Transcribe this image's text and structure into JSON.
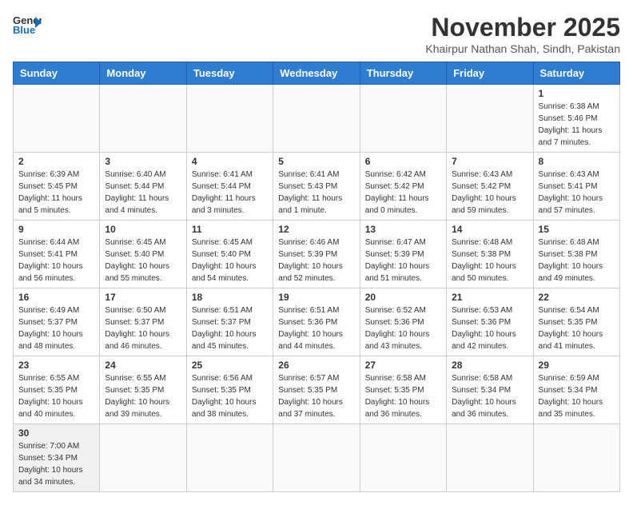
{
  "header": {
    "logo_line1": "General",
    "logo_line2": "Blue",
    "month_title": "November 2025",
    "location": "Khairpur Nathan Shah, Sindh, Pakistan"
  },
  "weekdays": [
    "Sunday",
    "Monday",
    "Tuesday",
    "Wednesday",
    "Thursday",
    "Friday",
    "Saturday"
  ],
  "weeks": [
    [
      {
        "day": "",
        "sunrise": "",
        "sunset": "",
        "daylight": ""
      },
      {
        "day": "",
        "sunrise": "",
        "sunset": "",
        "daylight": ""
      },
      {
        "day": "",
        "sunrise": "",
        "sunset": "",
        "daylight": ""
      },
      {
        "day": "",
        "sunrise": "",
        "sunset": "",
        "daylight": ""
      },
      {
        "day": "",
        "sunrise": "",
        "sunset": "",
        "daylight": ""
      },
      {
        "day": "",
        "sunrise": "",
        "sunset": "",
        "daylight": ""
      },
      {
        "day": "1",
        "sunrise": "Sunrise: 6:38 AM",
        "sunset": "Sunset: 5:46 PM",
        "daylight": "Daylight: 11 hours and 7 minutes."
      }
    ],
    [
      {
        "day": "2",
        "sunrise": "Sunrise: 6:39 AM",
        "sunset": "Sunset: 5:45 PM",
        "daylight": "Daylight: 11 hours and 5 minutes."
      },
      {
        "day": "3",
        "sunrise": "Sunrise: 6:40 AM",
        "sunset": "Sunset: 5:44 PM",
        "daylight": "Daylight: 11 hours and 4 minutes."
      },
      {
        "day": "4",
        "sunrise": "Sunrise: 6:41 AM",
        "sunset": "Sunset: 5:44 PM",
        "daylight": "Daylight: 11 hours and 3 minutes."
      },
      {
        "day": "5",
        "sunrise": "Sunrise: 6:41 AM",
        "sunset": "Sunset: 5:43 PM",
        "daylight": "Daylight: 11 hours and 1 minute."
      },
      {
        "day": "6",
        "sunrise": "Sunrise: 6:42 AM",
        "sunset": "Sunset: 5:42 PM",
        "daylight": "Daylight: 11 hours and 0 minutes."
      },
      {
        "day": "7",
        "sunrise": "Sunrise: 6:43 AM",
        "sunset": "Sunset: 5:42 PM",
        "daylight": "Daylight: 10 hours and 59 minutes."
      },
      {
        "day": "8",
        "sunrise": "Sunrise: 6:43 AM",
        "sunset": "Sunset: 5:41 PM",
        "daylight": "Daylight: 10 hours and 57 minutes."
      }
    ],
    [
      {
        "day": "9",
        "sunrise": "Sunrise: 6:44 AM",
        "sunset": "Sunset: 5:41 PM",
        "daylight": "Daylight: 10 hours and 56 minutes."
      },
      {
        "day": "10",
        "sunrise": "Sunrise: 6:45 AM",
        "sunset": "Sunset: 5:40 PM",
        "daylight": "Daylight: 10 hours and 55 minutes."
      },
      {
        "day": "11",
        "sunrise": "Sunrise: 6:45 AM",
        "sunset": "Sunset: 5:40 PM",
        "daylight": "Daylight: 10 hours and 54 minutes."
      },
      {
        "day": "12",
        "sunrise": "Sunrise: 6:46 AM",
        "sunset": "Sunset: 5:39 PM",
        "daylight": "Daylight: 10 hours and 52 minutes."
      },
      {
        "day": "13",
        "sunrise": "Sunrise: 6:47 AM",
        "sunset": "Sunset: 5:39 PM",
        "daylight": "Daylight: 10 hours and 51 minutes."
      },
      {
        "day": "14",
        "sunrise": "Sunrise: 6:48 AM",
        "sunset": "Sunset: 5:38 PM",
        "daylight": "Daylight: 10 hours and 50 minutes."
      },
      {
        "day": "15",
        "sunrise": "Sunrise: 6:48 AM",
        "sunset": "Sunset: 5:38 PM",
        "daylight": "Daylight: 10 hours and 49 minutes."
      }
    ],
    [
      {
        "day": "16",
        "sunrise": "Sunrise: 6:49 AM",
        "sunset": "Sunset: 5:37 PM",
        "daylight": "Daylight: 10 hours and 48 minutes."
      },
      {
        "day": "17",
        "sunrise": "Sunrise: 6:50 AM",
        "sunset": "Sunset: 5:37 PM",
        "daylight": "Daylight: 10 hours and 46 minutes."
      },
      {
        "day": "18",
        "sunrise": "Sunrise: 6:51 AM",
        "sunset": "Sunset: 5:37 PM",
        "daylight": "Daylight: 10 hours and 45 minutes."
      },
      {
        "day": "19",
        "sunrise": "Sunrise: 6:51 AM",
        "sunset": "Sunset: 5:36 PM",
        "daylight": "Daylight: 10 hours and 44 minutes."
      },
      {
        "day": "20",
        "sunrise": "Sunrise: 6:52 AM",
        "sunset": "Sunset: 5:36 PM",
        "daylight": "Daylight: 10 hours and 43 minutes."
      },
      {
        "day": "21",
        "sunrise": "Sunrise: 6:53 AM",
        "sunset": "Sunset: 5:36 PM",
        "daylight": "Daylight: 10 hours and 42 minutes."
      },
      {
        "day": "22",
        "sunrise": "Sunrise: 6:54 AM",
        "sunset": "Sunset: 5:35 PM",
        "daylight": "Daylight: 10 hours and 41 minutes."
      }
    ],
    [
      {
        "day": "23",
        "sunrise": "Sunrise: 6:55 AM",
        "sunset": "Sunset: 5:35 PM",
        "daylight": "Daylight: 10 hours and 40 minutes."
      },
      {
        "day": "24",
        "sunrise": "Sunrise: 6:55 AM",
        "sunset": "Sunset: 5:35 PM",
        "daylight": "Daylight: 10 hours and 39 minutes."
      },
      {
        "day": "25",
        "sunrise": "Sunrise: 6:56 AM",
        "sunset": "Sunset: 5:35 PM",
        "daylight": "Daylight: 10 hours and 38 minutes."
      },
      {
        "day": "26",
        "sunrise": "Sunrise: 6:57 AM",
        "sunset": "Sunset: 5:35 PM",
        "daylight": "Daylight: 10 hours and 37 minutes."
      },
      {
        "day": "27",
        "sunrise": "Sunrise: 6:58 AM",
        "sunset": "Sunset: 5:35 PM",
        "daylight": "Daylight: 10 hours and 36 minutes."
      },
      {
        "day": "28",
        "sunrise": "Sunrise: 6:58 AM",
        "sunset": "Sunset: 5:34 PM",
        "daylight": "Daylight: 10 hours and 36 minutes."
      },
      {
        "day": "29",
        "sunrise": "Sunrise: 6:59 AM",
        "sunset": "Sunset: 5:34 PM",
        "daylight": "Daylight: 10 hours and 35 minutes."
      }
    ],
    [
      {
        "day": "30",
        "sunrise": "Sunrise: 7:00 AM",
        "sunset": "Sunset: 5:34 PM",
        "daylight": "Daylight: 10 hours and 34 minutes."
      },
      {
        "day": "",
        "sunrise": "",
        "sunset": "",
        "daylight": ""
      },
      {
        "day": "",
        "sunrise": "",
        "sunset": "",
        "daylight": ""
      },
      {
        "day": "",
        "sunrise": "",
        "sunset": "",
        "daylight": ""
      },
      {
        "day": "",
        "sunrise": "",
        "sunset": "",
        "daylight": ""
      },
      {
        "day": "",
        "sunrise": "",
        "sunset": "",
        "daylight": ""
      },
      {
        "day": "",
        "sunrise": "",
        "sunset": "",
        "daylight": ""
      }
    ]
  ]
}
